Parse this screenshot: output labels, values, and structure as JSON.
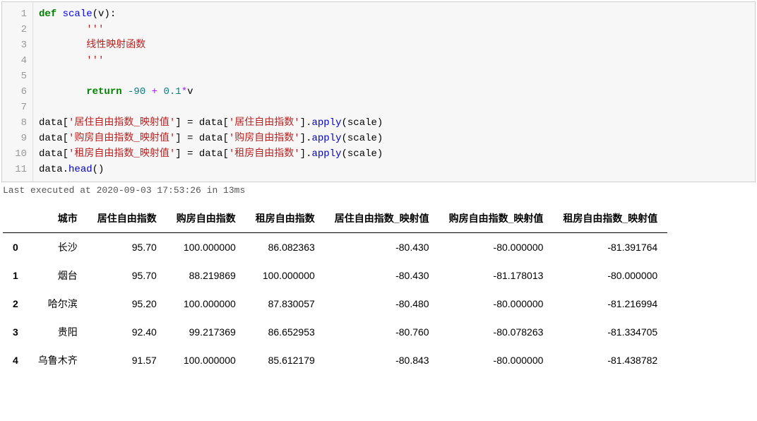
{
  "code": {
    "lines": [
      1,
      2,
      3,
      4,
      5,
      6,
      7,
      8,
      9,
      10,
      11
    ],
    "fold_at_line": 1,
    "l1_def": "def ",
    "l1_name": "scale",
    "l1_paren": "(v):",
    "l2": "        '''",
    "l3": "        线性映射函数",
    "l4": "        '''",
    "l5": "",
    "l6_ret": "        return ",
    "l6_n1": "-90",
    "l6_plus": " + ",
    "l6_n2": "0.1",
    "l6_mul": "*",
    "l6_v": "v",
    "l7": "",
    "l8_a": "data[",
    "l8_s1": "'居住自由指数_映射值'",
    "l8_b": "] = data[",
    "l8_s2": "'居住自由指数'",
    "l8_c": "].",
    "l8_apply": "apply",
    "l8_d": "(scale)",
    "l9_a": "data[",
    "l9_s1": "'购房自由指数_映射值'",
    "l9_b": "] = data[",
    "l9_s2": "'购房自由指数'",
    "l9_c": "].",
    "l9_apply": "apply",
    "l9_d": "(scale)",
    "l10_a": "data[",
    "l10_s1": "'租房自由指数_映射值'",
    "l10_b": "] = data[",
    "l10_s2": "'租房自由指数'",
    "l10_c": "].",
    "l10_apply": "apply",
    "l10_d": "(scale)",
    "l11_a": "data.",
    "l11_head": "head",
    "l11_b": "()"
  },
  "exec_info": "Last executed at 2020-09-03 17:53:26 in 13ms",
  "table": {
    "headers": [
      "",
      "城市",
      "居住自由指数",
      "购房自由指数",
      "租房自由指数",
      "居住自由指数_映射值",
      "购房自由指数_映射值",
      "租房自由指数_映射值"
    ],
    "rows": [
      {
        "idx": "0",
        "c0": "长沙",
        "c1": "95.70",
        "c2": "100.000000",
        "c3": "86.082363",
        "c4": "-80.430",
        "c5": "-80.000000",
        "c6": "-81.391764"
      },
      {
        "idx": "1",
        "c0": "烟台",
        "c1": "95.70",
        "c2": "88.219869",
        "c3": "100.000000",
        "c4": "-80.430",
        "c5": "-81.178013",
        "c6": "-80.000000"
      },
      {
        "idx": "2",
        "c0": "哈尔滨",
        "c1": "95.20",
        "c2": "100.000000",
        "c3": "87.830057",
        "c4": "-80.480",
        "c5": "-80.000000",
        "c6": "-81.216994"
      },
      {
        "idx": "3",
        "c0": "贵阳",
        "c1": "92.40",
        "c2": "99.217369",
        "c3": "86.652953",
        "c4": "-80.760",
        "c5": "-80.078263",
        "c6": "-81.334705"
      },
      {
        "idx": "4",
        "c0": "乌鲁木齐",
        "c1": "91.57",
        "c2": "100.000000",
        "c3": "85.612179",
        "c4": "-80.843",
        "c5": "-80.000000",
        "c6": "-81.438782"
      }
    ]
  }
}
